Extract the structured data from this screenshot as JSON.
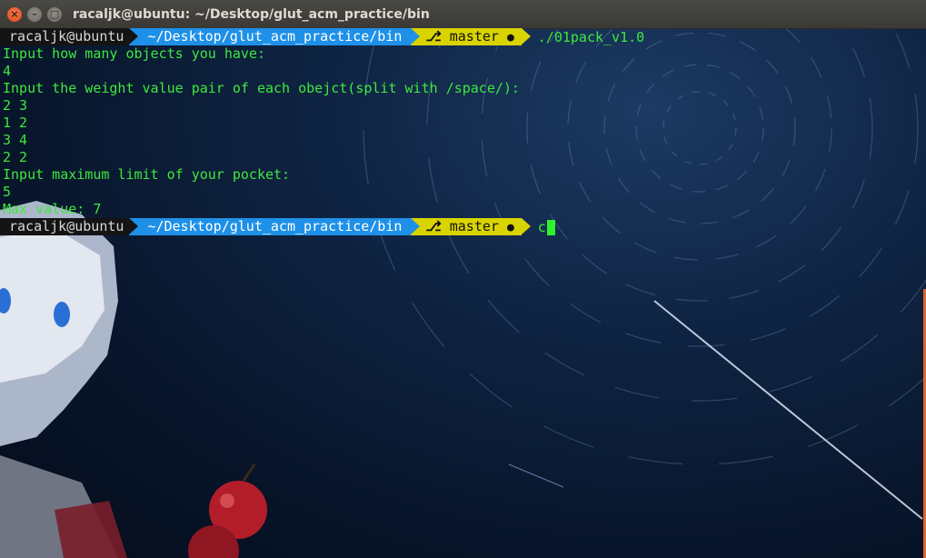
{
  "window": {
    "title": "racaljk@ubuntu: ~/Desktop/glut_acm_practice/bin",
    "buttons": {
      "close": "×",
      "minimize": "–",
      "maximize": "□"
    }
  },
  "prompts": [
    {
      "user": "racaljk@ubuntu",
      "path": "~/Desktop/glut_acm_practice/bin",
      "branch_icon": "⎇",
      "branch": "master",
      "status_icon": "●",
      "command": "./01pack_v1.0"
    },
    {
      "user": "racaljk@ubuntu",
      "path": "~/Desktop/glut_acm_practice/bin",
      "branch_icon": "⎇",
      "branch": "master",
      "status_icon": "●",
      "command": "c"
    }
  ],
  "output": [
    "Input how many objects you have:",
    "4",
    "Input the weight value pair of each obejct(split with /space/):",
    "2 3",
    "1 2",
    "3 4",
    "2 2",
    "Input maximum limit of your pocket:",
    "5",
    "Max value: 7"
  ],
  "colors": {
    "terminal_text": "#3ee83e",
    "path_segment": "#1e90e8",
    "git_segment": "#d9d400",
    "user_segment": "#141414",
    "close_button": "#dd4814"
  }
}
